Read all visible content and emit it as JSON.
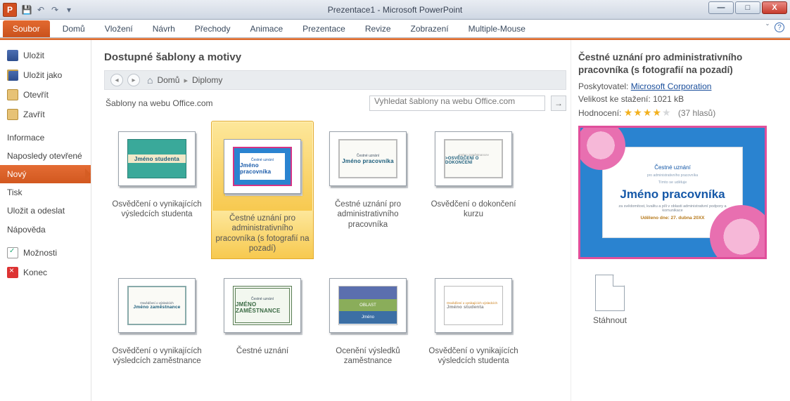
{
  "titlebar": {
    "title": "Prezentace1  -  Microsoft PowerPoint",
    "app_letter": "P"
  },
  "ribbon": {
    "file": "Soubor",
    "tabs": [
      "Domů",
      "Vložení",
      "Návrh",
      "Přechody",
      "Animace",
      "Prezentace",
      "Revize",
      "Zobrazení",
      "Multiple-Mouse"
    ]
  },
  "left": {
    "save": "Uložit",
    "saveas": "Uložit jako",
    "open": "Otevřít",
    "close": "Zavřít",
    "info": "Informace",
    "recent": "Naposledy otevřené",
    "new": "Nový",
    "print": "Tisk",
    "send": "Uložit a odeslat",
    "help": "Nápověda",
    "options": "Možnosti",
    "exit": "Konec"
  },
  "center": {
    "heading": "Dostupné šablony a motivy",
    "crumb_home": "Domů",
    "crumb_cat": "Diplomy",
    "sourceLabel": "Šablony na webu Office.com",
    "searchPlaceholder": "Vyhledat šablony na webu Office.com",
    "tiles": [
      {
        "caption": "Osvědčení o vynikajících výsledcích studenta",
        "thumb": "Jméno studenta"
      },
      {
        "caption": "Čestné uznání pro administrativního pracovníka (s fotografií na pozadí)",
        "thumb": "Jméno pracovníka"
      },
      {
        "caption": "Čestné uznání pro administrativního pracovníka",
        "thumb": "Jméno pracovníka"
      },
      {
        "caption": "Osvědčení o dokončení kurzu",
        "thumb": ">OSVĚDČENÍ O DOKONČENÍ"
      },
      {
        "caption": "Osvědčení o vynikajících výsledcích zaměstnance",
        "thumb": "Jméno zaměstnance"
      },
      {
        "caption": "Čestné uznání",
        "thumb": "JMÉNO ZAMĚSTNANCE"
      },
      {
        "caption": "Ocenění výsledků zaměstnance",
        "thumb": "Jméno"
      },
      {
        "caption": "Osvědčení o vynikajících výsledcích studenta",
        "thumb": "Jméno studenta"
      }
    ]
  },
  "right": {
    "title": "Čestné uznání pro administrativního pracovníka (s fotografií na pozadí)",
    "providerLabel": "Poskytovatel:",
    "provider": "Microsoft Corporation",
    "sizeLabel": "Velikost ke stažení:",
    "size": "1021 kB",
    "ratingLabel": "Hodnocení:",
    "votes": "(37 hlasů)",
    "preview_small1": "Čestné uznání",
    "preview_small2": "Jméno pracovníka",
    "preview_date": "Uděleno dne: 27. dubna 20XX",
    "download": "Stáhnout"
  }
}
